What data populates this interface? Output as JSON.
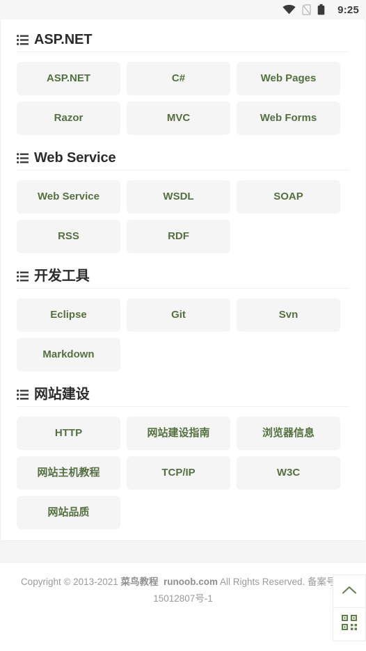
{
  "statusbar": {
    "time": "9:25",
    "icons": [
      "wifi-icon",
      "no-sim-icon",
      "battery-icon"
    ]
  },
  "sections": [
    {
      "id": "aspnet",
      "title": "ASP.NET",
      "icon": "list-icon",
      "items": [
        {
          "label": "ASP.NET",
          "cjk": false
        },
        {
          "label": "C#",
          "cjk": false
        },
        {
          "label": "Web Pages",
          "cjk": false
        },
        {
          "label": "Razor",
          "cjk": false
        },
        {
          "label": "MVC",
          "cjk": false
        },
        {
          "label": "Web Forms",
          "cjk": false
        }
      ]
    },
    {
      "id": "webservice",
      "title": "Web Service",
      "icon": "list-icon",
      "items": [
        {
          "label": "Web Service",
          "cjk": false
        },
        {
          "label": "WSDL",
          "cjk": false
        },
        {
          "label": "SOAP",
          "cjk": false
        },
        {
          "label": "RSS",
          "cjk": false
        },
        {
          "label": "RDF",
          "cjk": false
        }
      ]
    },
    {
      "id": "devtools",
      "title": "开发工具",
      "icon": "list-icon",
      "items": [
        {
          "label": "Eclipse",
          "cjk": false
        },
        {
          "label": "Git",
          "cjk": false
        },
        {
          "label": "Svn",
          "cjk": false
        },
        {
          "label": "Markdown",
          "cjk": false
        }
      ]
    },
    {
      "id": "website",
      "title": "网站建设",
      "icon": "list-icon",
      "items": [
        {
          "label": "HTTP",
          "cjk": false
        },
        {
          "label": "网站建设指南",
          "cjk": true
        },
        {
          "label": "浏览器信息",
          "cjk": true
        },
        {
          "label": "网站主机教程",
          "cjk": true
        },
        {
          "label": "TCP/IP",
          "cjk": false
        },
        {
          "label": "W3C",
          "cjk": false
        },
        {
          "label": "网站品质",
          "cjk": true
        }
      ]
    }
  ],
  "footer": {
    "copyright_prefix": "Copyright © 2013-2021 ",
    "site_name": "菜鸟教程",
    "site_domain": "runoob.com",
    "rights": " All Rights Reserved. 备案号：",
    "icp": "15012807号-1"
  },
  "fabs": [
    {
      "name": "scroll-to-top-button",
      "icon": "chevron-up-icon"
    },
    {
      "name": "qrcode-button",
      "icon": "qr-code-icon"
    }
  ],
  "colors": {
    "link_green": "#557040",
    "chip_bg": "#f5f5f5",
    "title": "#2b2b2b",
    "footer_text": "#9a9a9a"
  }
}
